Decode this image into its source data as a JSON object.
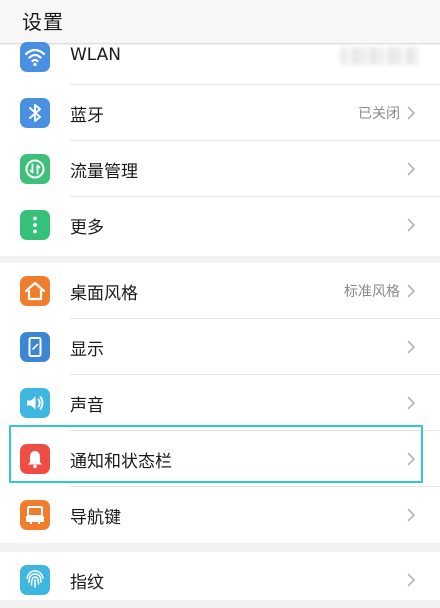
{
  "header": {
    "title": "设置"
  },
  "colors": {
    "wlan": "#4a90e2",
    "bluetooth": "#4a90e2",
    "traffic": "#3fc07a",
    "more": "#35c17a",
    "desktop": "#f07d2e",
    "display": "#3d86d6",
    "sound": "#3db6e0",
    "notification": "#ef4d43",
    "navigation": "#f07d2e",
    "fingerprint": "#3db6e0",
    "highlight": "#34c9c9"
  },
  "sections": [
    {
      "items": [
        {
          "label": "WLAN",
          "icon": "wifi-icon",
          "value": ""
        },
        {
          "label": "蓝牙",
          "icon": "bluetooth-icon",
          "value": "已关闭"
        },
        {
          "label": "流量管理",
          "icon": "data-usage-icon",
          "value": ""
        },
        {
          "label": "更多",
          "icon": "more-icon",
          "value": ""
        }
      ]
    },
    {
      "items": [
        {
          "label": "桌面风格",
          "icon": "home-icon",
          "value": "标准风格"
        },
        {
          "label": "显示",
          "icon": "display-icon",
          "value": ""
        },
        {
          "label": "声音",
          "icon": "speaker-icon",
          "value": ""
        },
        {
          "label": "通知和状态栏",
          "icon": "bell-icon",
          "value": ""
        },
        {
          "label": "导航键",
          "icon": "navigation-icon",
          "value": ""
        }
      ]
    },
    {
      "items": [
        {
          "label": "指纹",
          "icon": "fingerprint-icon",
          "value": ""
        }
      ]
    }
  ]
}
